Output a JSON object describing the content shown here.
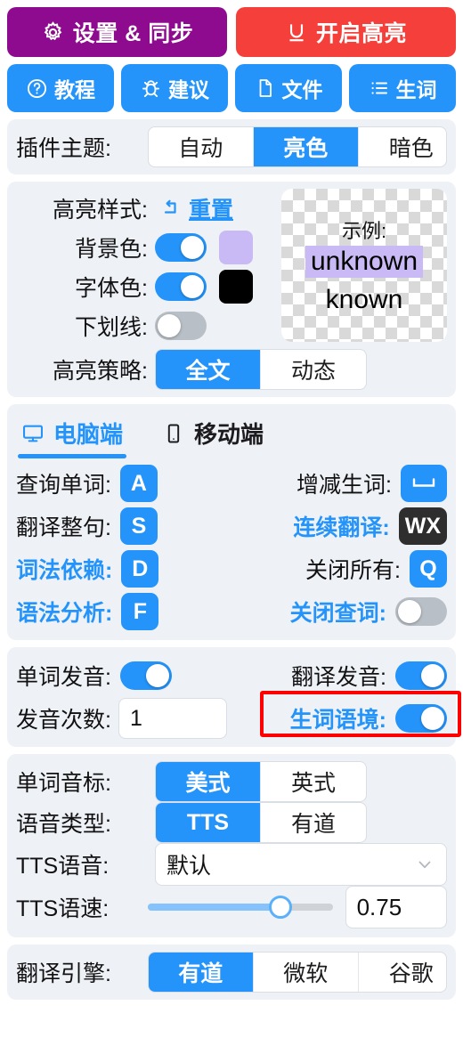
{
  "header": {
    "settings_button": {
      "label": "设置 & 同步",
      "icon": "gear-icon",
      "color": "#8e0a8e"
    },
    "highlight_button": {
      "label": "开启高亮",
      "icon": "underline-icon",
      "color": "#f53f3a"
    },
    "nav_buttons": [
      {
        "label": "教程",
        "icon": "question-circle-icon"
      },
      {
        "label": "建议",
        "icon": "bug-icon"
      },
      {
        "label": "文件",
        "icon": "file-icon"
      },
      {
        "label": "生词",
        "icon": "list-icon"
      }
    ]
  },
  "theme": {
    "label": "插件主题:",
    "options": [
      "自动",
      "亮色",
      "暗色"
    ],
    "selected": "亮色"
  },
  "highlight_style": {
    "label": "高亮样式:",
    "reset_label": "重置",
    "reset_icon": "undo-icon",
    "rows": [
      {
        "label": "背景色:",
        "toggle": "on",
        "swatch": "#c9b9f5"
      },
      {
        "label": "字体色:",
        "toggle": "on",
        "swatch": "#000000"
      },
      {
        "label": "下划线:",
        "toggle": "off",
        "swatch": null
      }
    ],
    "preview": {
      "title": "示例:",
      "unknown_word": "unknown",
      "known_word": "known",
      "highlight_color": "#c9b9f5"
    },
    "strategy": {
      "label": "高亮策略:",
      "options": [
        "全文",
        "动态"
      ],
      "selected": "全文"
    }
  },
  "platform_tabs": [
    {
      "label": "电脑端",
      "icon": "monitor-icon",
      "active": true
    },
    {
      "label": "移动端",
      "icon": "phone-icon",
      "active": false
    }
  ],
  "shortcuts": {
    "left": [
      {
        "label": "查询单词:",
        "key": "A",
        "key_style": "blue",
        "label_blue": false
      },
      {
        "label": "翻译整句:",
        "key": "S",
        "key_style": "blue",
        "label_blue": false
      },
      {
        "label": "词法依赖:",
        "key": "D",
        "key_style": "blue",
        "label_blue": true
      },
      {
        "label": "语法分析:",
        "key": "F",
        "key_style": "blue",
        "label_blue": true
      }
    ],
    "right": [
      {
        "label": "增减生词:",
        "key": "space-bar-icon",
        "key_style": "blue",
        "label_blue": false,
        "is_icon": true
      },
      {
        "label": "连续翻译:",
        "key": "WX",
        "key_style": "dark",
        "label_blue": true
      },
      {
        "label": "关闭所有:",
        "key": "Q",
        "key_style": "blue",
        "label_blue": false
      },
      {
        "label": "关闭查词:",
        "key": null,
        "toggle": "off",
        "label_blue": true
      }
    ]
  },
  "audio": {
    "word_pronounce": {
      "label": "单词发音:",
      "toggle": "on"
    },
    "translate_pronounce": {
      "label": "翻译发音:",
      "toggle": "on",
      "annotated": true
    },
    "pronounce_count": {
      "label": "发音次数:",
      "value": "1"
    },
    "word_context": {
      "label": "生词语境:",
      "toggle": "on",
      "label_blue": true
    },
    "phonetic": {
      "label": "单词音标:",
      "options": [
        "美式",
        "英式"
      ],
      "selected": "美式"
    },
    "voice_type": {
      "label": "语音类型:",
      "options": [
        "TTS",
        "有道"
      ],
      "selected": "TTS"
    },
    "tts_voice": {
      "label": "TTS语音:",
      "value": "默认",
      "icon": "chevron-down-icon"
    },
    "tts_speed": {
      "label": "TTS语速:",
      "value": "0.75",
      "percent": 72
    }
  },
  "translate_engine": {
    "label": "翻译引擎:",
    "options": [
      "有道",
      "微软",
      "谷歌"
    ],
    "selected": "有道"
  },
  "colors": {
    "accent": "#2494fa",
    "purple": "#8e0a8e",
    "red": "#f53f3a",
    "annotation": "#ff0000",
    "panel_bg": "#eef1f6"
  }
}
